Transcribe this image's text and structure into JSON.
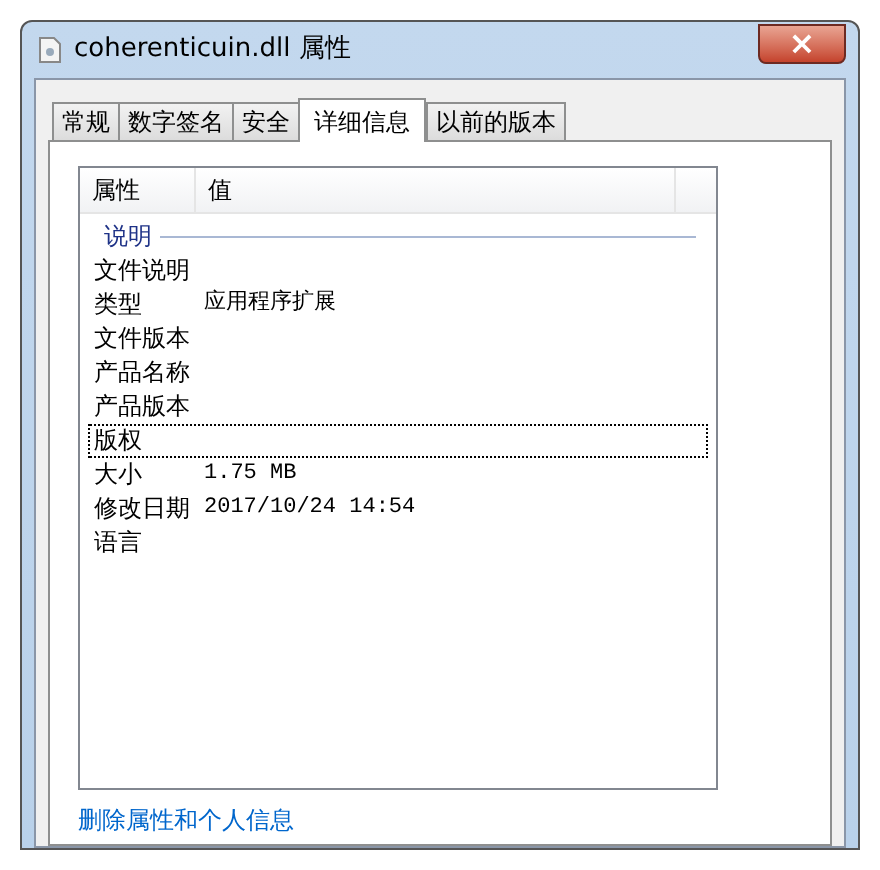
{
  "window": {
    "title": "coherenticuin.dll 属性",
    "close": "×"
  },
  "tabs": [
    {
      "label": "常规",
      "selected": false
    },
    {
      "label": "数字签名",
      "selected": false
    },
    {
      "label": "安全",
      "selected": false
    },
    {
      "label": "详细信息",
      "selected": true
    },
    {
      "label": "以前的版本",
      "selected": false
    }
  ],
  "table": {
    "columns": [
      "属性",
      "值"
    ],
    "group": "说明",
    "rows": [
      {
        "name": "文件说明",
        "selected": false
      },
      {
        "name": "类型",
        "value": "应用程序扩展",
        "selected": false
      },
      {
        "name": "文件版本",
        "selected": false
      },
      {
        "name": "产品名称",
        "selected": false
      },
      {
        "name": "产品版本",
        "selected": false
      },
      {
        "name": "版权",
        "selected": true
      },
      {
        "name": "大小",
        "value": "1.75 MB",
        "selected": false
      },
      {
        "name": "修改日期",
        "value": "2017/10/24 14:54",
        "selected": false
      },
      {
        "name": "语言",
        "selected": false
      }
    ]
  },
  "link": "删除属性和个人信息"
}
